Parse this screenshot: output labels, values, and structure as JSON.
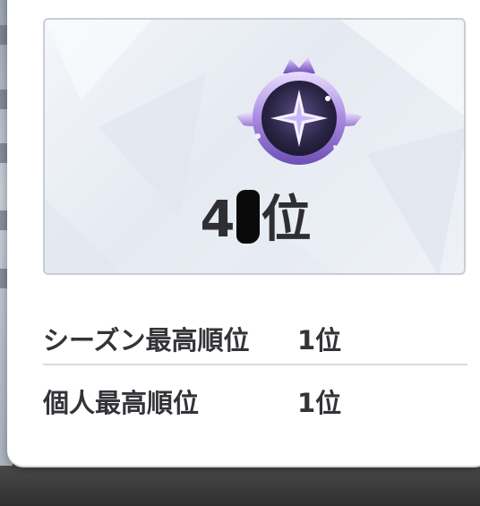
{
  "rank_card": {
    "rank_prefix": "4",
    "rank_suffix": "位",
    "emblem_icon": "purple-star-crest-icon"
  },
  "stats": [
    {
      "label": "シーズン最高順位",
      "value": "1位"
    },
    {
      "label": "個人最高順位",
      "value": "1位"
    }
  ],
  "colors": {
    "text_dark": "#333338",
    "card_border": "#c9ced6",
    "emblem_purple": "#8a6bd6",
    "divider": "#d7d9dd"
  }
}
